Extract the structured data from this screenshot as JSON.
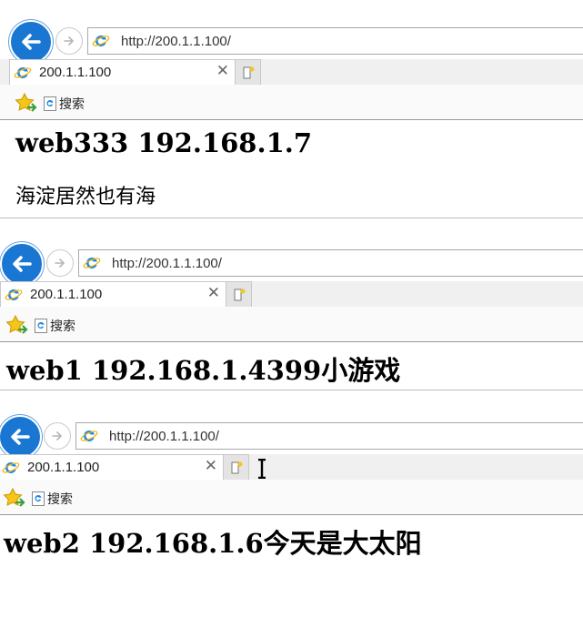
{
  "windows": [
    {
      "address": "http://200.1.1.100/",
      "tab_title": "200.1.1.100",
      "favorites_label": "搜索",
      "heading": "web333 192.168.1.7",
      "paragraph": "海淀居然也有海"
    },
    {
      "address": "http://200.1.1.100/",
      "tab_title": "200.1.1.100",
      "favorites_label": "搜索",
      "heading": "web1 192.168.1.4399小游戏"
    },
    {
      "address": "http://200.1.1.100/",
      "tab_title": "200.1.1.100",
      "favorites_label": "搜索",
      "heading": "web2 192.168.1.6今天是大太阳"
    }
  ],
  "icons": {
    "back": "back-arrow-icon",
    "forward": "forward-arrow-icon",
    "page": "ie-logo-icon",
    "close": "close-icon",
    "new_tab": "new-tab-icon",
    "favorites": "favorites-star-icon"
  },
  "colors": {
    "back_button": "#1976d2",
    "ie_logo": "#1e88e5",
    "star": "#f5c518"
  }
}
